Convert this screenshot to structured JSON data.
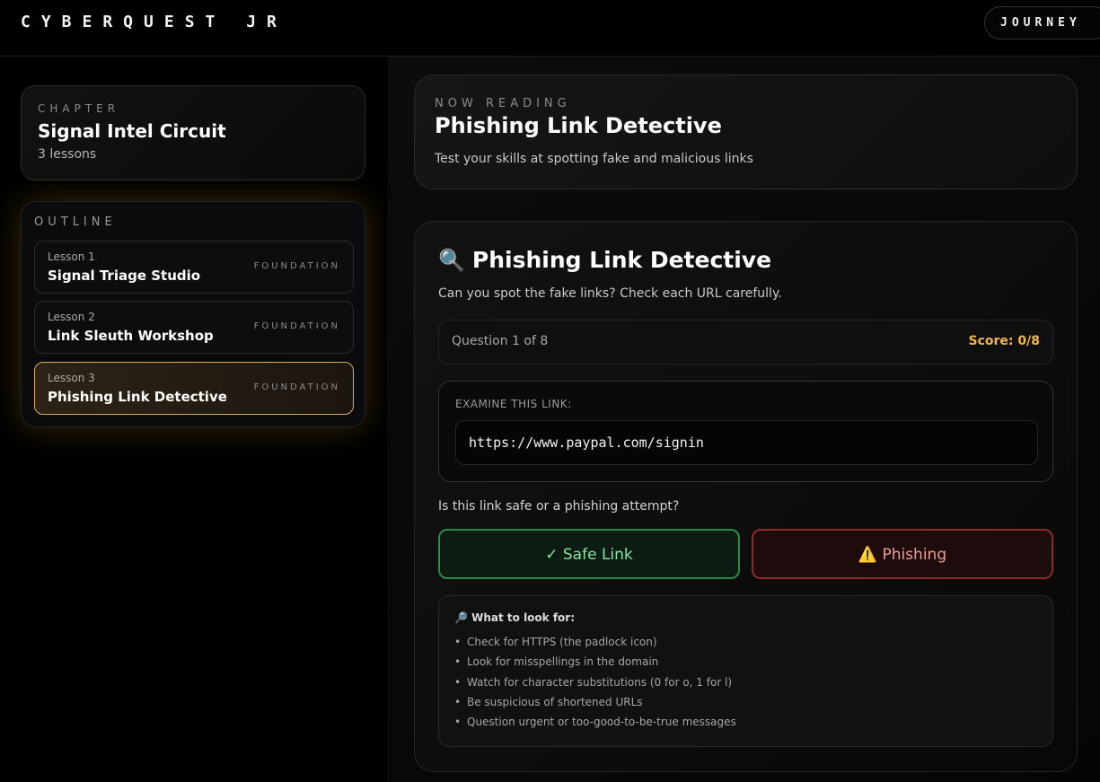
{
  "header": {
    "brand": "CYBERQUEST JR",
    "journey_label": "JOURNEY"
  },
  "sidebar": {
    "chapter_label": "CHAPTER",
    "chapter_title": "Signal Intel Circuit",
    "chapter_count": "3 lessons",
    "outline_label": "OUTLINE",
    "lessons": [
      {
        "number": "Lesson 1",
        "title": "Signal Triage Studio",
        "tag": "FOUNDATION",
        "active": false
      },
      {
        "number": "Lesson 2",
        "title": "Link Sleuth Workshop",
        "tag": "FOUNDATION",
        "active": false
      },
      {
        "number": "Lesson 3",
        "title": "Phishing Link Detective",
        "tag": "FOUNDATION",
        "active": true
      }
    ]
  },
  "main": {
    "now_reading_label": "NOW READING",
    "lesson_title": "Phishing Link Detective",
    "lesson_subtitle": "Test your skills at spotting fake and malicious links",
    "quiz": {
      "icon": "magnifier-icon",
      "icon_glyph": "🔍",
      "title": "Phishing Link Detective",
      "subtitle": "Can you spot the fake links? Check each URL carefully.",
      "question_count": "Question 1 of 8",
      "score": "Score: 0/8",
      "examine_label": "EXAMINE THIS LINK:",
      "url": "https://www.paypal.com/signin",
      "question": "Is this link safe or a phishing attempt?",
      "safe_label": "✓ Safe Link",
      "phishing_label": "⚠️ Phishing",
      "tips_title": "🔎 What to look for:",
      "tips": [
        "Check for HTTPS (the padlock icon)",
        "Look for misspellings in the domain",
        "Watch for character substitutions (0 for o, 1 for l)",
        "Be suspicious of shortened URLs",
        "Question urgent or too-good-to-be-true messages"
      ]
    }
  },
  "colors": {
    "accent_gold": "#d8ac5c",
    "score_gold": "#f2b84a",
    "safe_green": "#2a8a4a",
    "phish_red": "#8a2c2c"
  }
}
